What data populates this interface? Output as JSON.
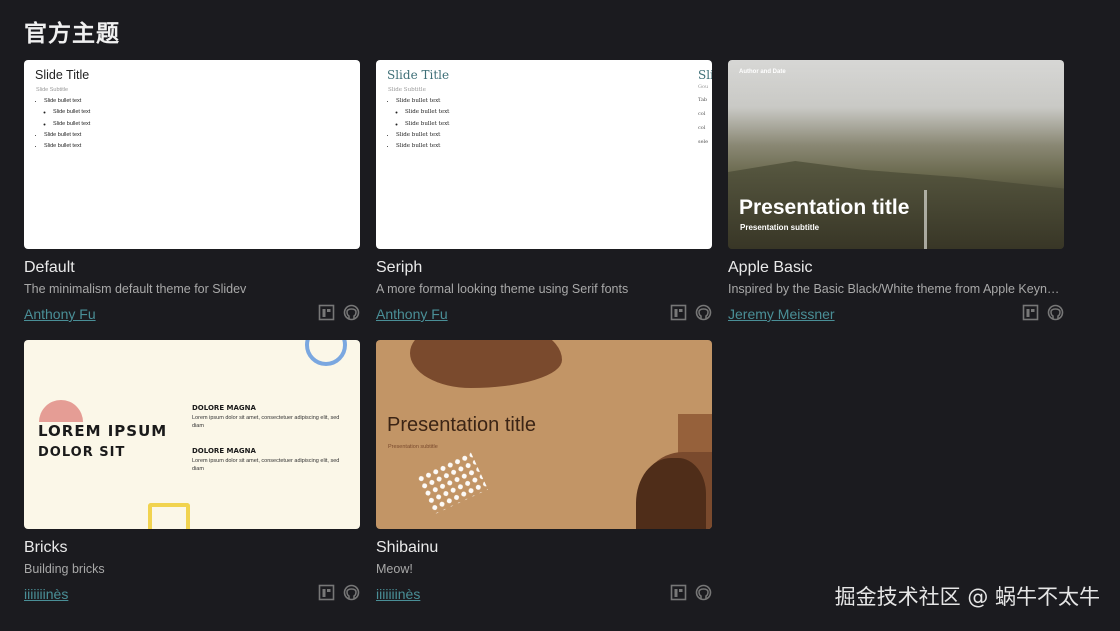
{
  "page": {
    "heading": "官方主题"
  },
  "themes": [
    {
      "title": "Default",
      "description": "The minimalism default theme for Slidev",
      "author": "Anthony Fu",
      "preview": {
        "slide_title": "Slide Title",
        "slide_subtitle": "Slide Subtitle",
        "bullets": [
          "Slide bullet text",
          "Slide bullet text",
          "Slide bullet text",
          "Slide bullet text",
          "Slide bullet text"
        ]
      }
    },
    {
      "title": "Seriph",
      "description": "A more formal looking theme using Serif fonts",
      "author": "Anthony Fu",
      "preview": {
        "slide_title": "Slide Title",
        "slide_subtitle": "Slide Subtitle",
        "bullets": [
          "Slide bullet text",
          "Slide bullet text",
          "Slide bullet text",
          "Slide bullet text",
          "Slide bullet text"
        ],
        "edge_title": "Sli",
        "edge_sub": "Gou",
        "edge_lines": [
          "Tab",
          "col",
          "col",
          "sele"
        ]
      }
    },
    {
      "title": "Apple Basic",
      "description": "Inspired by the Basic Black/White theme from Apple Keynote",
      "author": "Jeremy Meissner",
      "preview": {
        "author_date": "Author and Date",
        "title": "Presentation title",
        "subtitle": "Presentation subtitle"
      }
    },
    {
      "title": "Bricks",
      "description": "Building bricks",
      "author": "iiiiiiinès",
      "preview": {
        "big_line1": "LOREM IPSUM",
        "big_line2": "DOLOR SIT",
        "section1_title": "DOLORE MAGNA",
        "section1_text": "Lorem ipsum dolor sit amet, consectetuer adipiscing elit, sed diam",
        "section2_title": "DOLORE MAGNA",
        "section2_text": "Lorem ipsum dolor sit amet, consectetuer adipiscing elit, sed diam"
      }
    },
    {
      "title": "Shibainu",
      "description": "Meow!",
      "author": "iiiiiiinès",
      "preview": {
        "title": "Presentation title",
        "subtitle": "Presentation subtitle"
      }
    }
  ],
  "icons": {
    "preview": "layout-preview-icon",
    "repo": "github-icon"
  },
  "colors": {
    "background": "#1b1b1f",
    "author_link": "#4a8f97"
  },
  "watermark": "掘金技术社区 @ 蜗牛不太牛"
}
